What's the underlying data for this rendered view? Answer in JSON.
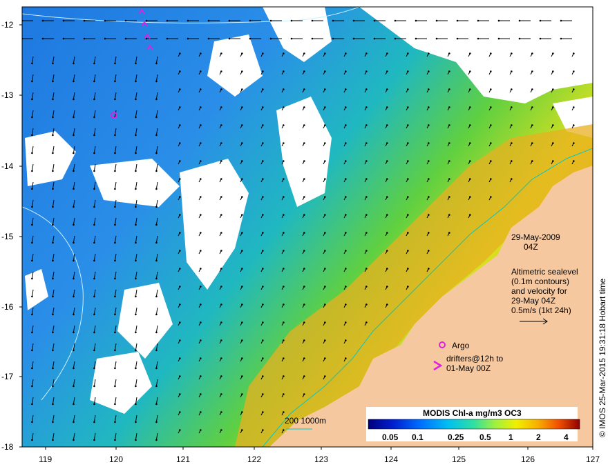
{
  "y_ticks": [
    "-12",
    "-13",
    "-14",
    "-15",
    "-16",
    "-17",
    "-18"
  ],
  "x_ticks": [
    "119",
    "120",
    "121",
    "122",
    "123",
    "124",
    "125",
    "126",
    "127"
  ],
  "date_line1": "29-May-2009",
  "date_line2": "04Z",
  "altimetry": [
    "Altimetric sealevel",
    "(0.1m contours)",
    "and velocity for",
    "29-May 04Z",
    "0.5m/s (1kt 24h)"
  ],
  "argo_label": "Argo",
  "drifters": [
    "drifters@12h to",
    "01-May 00Z"
  ],
  "depth_label": "200  1000m",
  "colorbar": {
    "title": "MODIS Chl-a mg/m3 OC3",
    "labels": [
      "0.05",
      "0.1",
      "0.25",
      "0.5",
      "1",
      "2",
      "4"
    ]
  },
  "credit": "© IMOS 25-Mar-2015 19:31:18 Hobart time",
  "colors": {
    "land": "#f6c8a0",
    "argo": "#e020e0",
    "depth_contour": "#00c8c8"
  }
}
